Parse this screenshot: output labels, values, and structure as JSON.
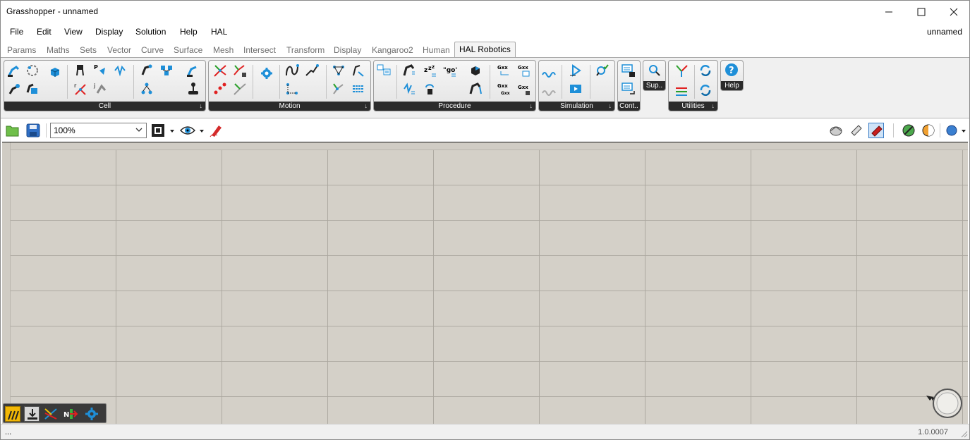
{
  "window": {
    "title": "Grasshopper - unnamed"
  },
  "menu": {
    "items": [
      "File",
      "Edit",
      "View",
      "Display",
      "Solution",
      "Help",
      "HAL"
    ],
    "document": "unnamed"
  },
  "tabs": [
    "Params",
    "Maths",
    "Sets",
    "Vector",
    "Curve",
    "Surface",
    "Mesh",
    "Intersect",
    "Transform",
    "Display",
    "Kangaroo2",
    "Human",
    "HAL Robotics"
  ],
  "ribbon": {
    "groups": [
      "Cell",
      "Motion",
      "Procedure",
      "Simulation",
      "Cont..",
      "Sup..",
      "Utilities",
      "Help"
    ],
    "expand_glyph": "↓"
  },
  "toolbar": {
    "zoom": "100%"
  },
  "status": {
    "left": "...",
    "version": "1.0.0007"
  },
  "colors": {
    "accent_blue": "#1e8fd8",
    "canvas": "#d4d0c8",
    "ribbon_label": "#2b2b2b"
  }
}
